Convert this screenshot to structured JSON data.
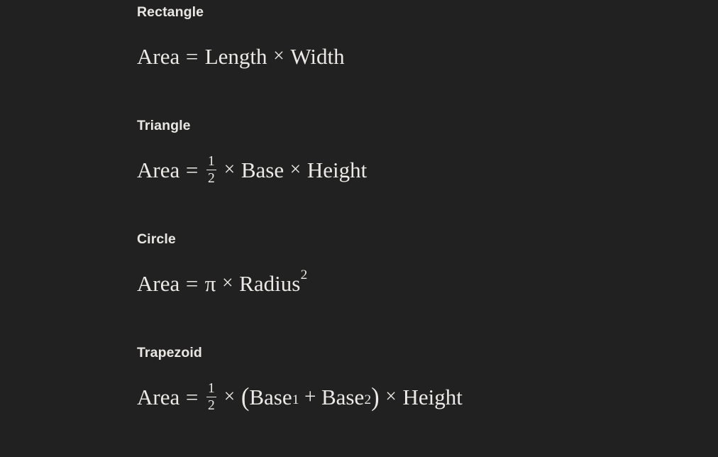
{
  "page": {
    "background_color": "#212121",
    "text_color": "#e9e7e4",
    "formula_color": "#eceae7"
  },
  "sections": [
    {
      "heading": "Rectangle",
      "formula_plain": "Area = Length × Width",
      "lhs": "Area",
      "equals": "=",
      "times": "×",
      "term1": "Length",
      "term2": "Width"
    },
    {
      "heading": "Triangle",
      "formula_plain": "Area = 1/2 × Base × Height",
      "lhs": "Area",
      "equals": "=",
      "times": "×",
      "frac_num": "1",
      "frac_den": "2",
      "term1": "Base",
      "term2": "Height"
    },
    {
      "heading": "Circle",
      "formula_plain": "Area = π × Radius²",
      "lhs": "Area",
      "equals": "=",
      "times": "×",
      "pi": "π",
      "term1": "Radius",
      "exponent": "2"
    },
    {
      "heading": "Trapezoid",
      "formula_plain": "Area = 1/2 × (Base₁ + Base₂) × Height",
      "lhs": "Area",
      "equals": "=",
      "times": "×",
      "plus": "+",
      "paren_open": "(",
      "paren_close": ")",
      "frac_num": "1",
      "frac_den": "2",
      "term1": "Base",
      "sub1": "1",
      "term2": "Base",
      "sub2": "2",
      "term3": "Height"
    }
  ]
}
